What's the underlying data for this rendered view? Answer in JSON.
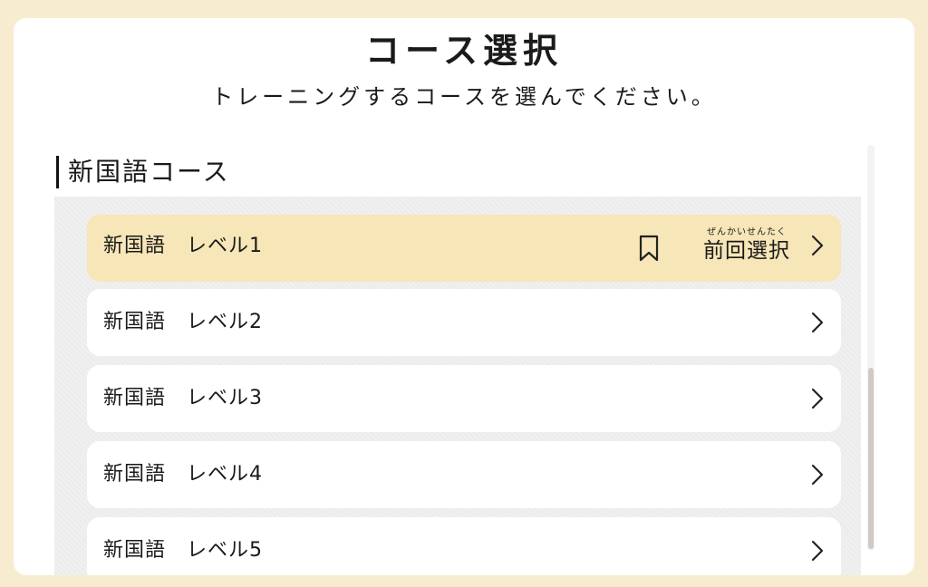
{
  "header": {
    "title": "コース選択",
    "subtitle": "トレーニングするコースを選んでください。"
  },
  "section": {
    "title": "新国語コース"
  },
  "courses": [
    {
      "label": "新国語　レベル1",
      "selected": true
    },
    {
      "label": "新国語　レベル2",
      "selected": false
    },
    {
      "label": "新国語　レベル3",
      "selected": false
    },
    {
      "label": "新国語　レベル4",
      "selected": false
    },
    {
      "label": "新国語　レベル5",
      "selected": false
    }
  ],
  "previous_badge": {
    "label": "前回選択",
    "ruby": "ぜんかいせんたく",
    "icon": "bookmark-icon"
  },
  "icons": {
    "chevron": "chevron-right-icon"
  },
  "colors": {
    "background": "#f8ecd0",
    "selected_item": "#f6e6b8",
    "card": "#ffffff"
  }
}
